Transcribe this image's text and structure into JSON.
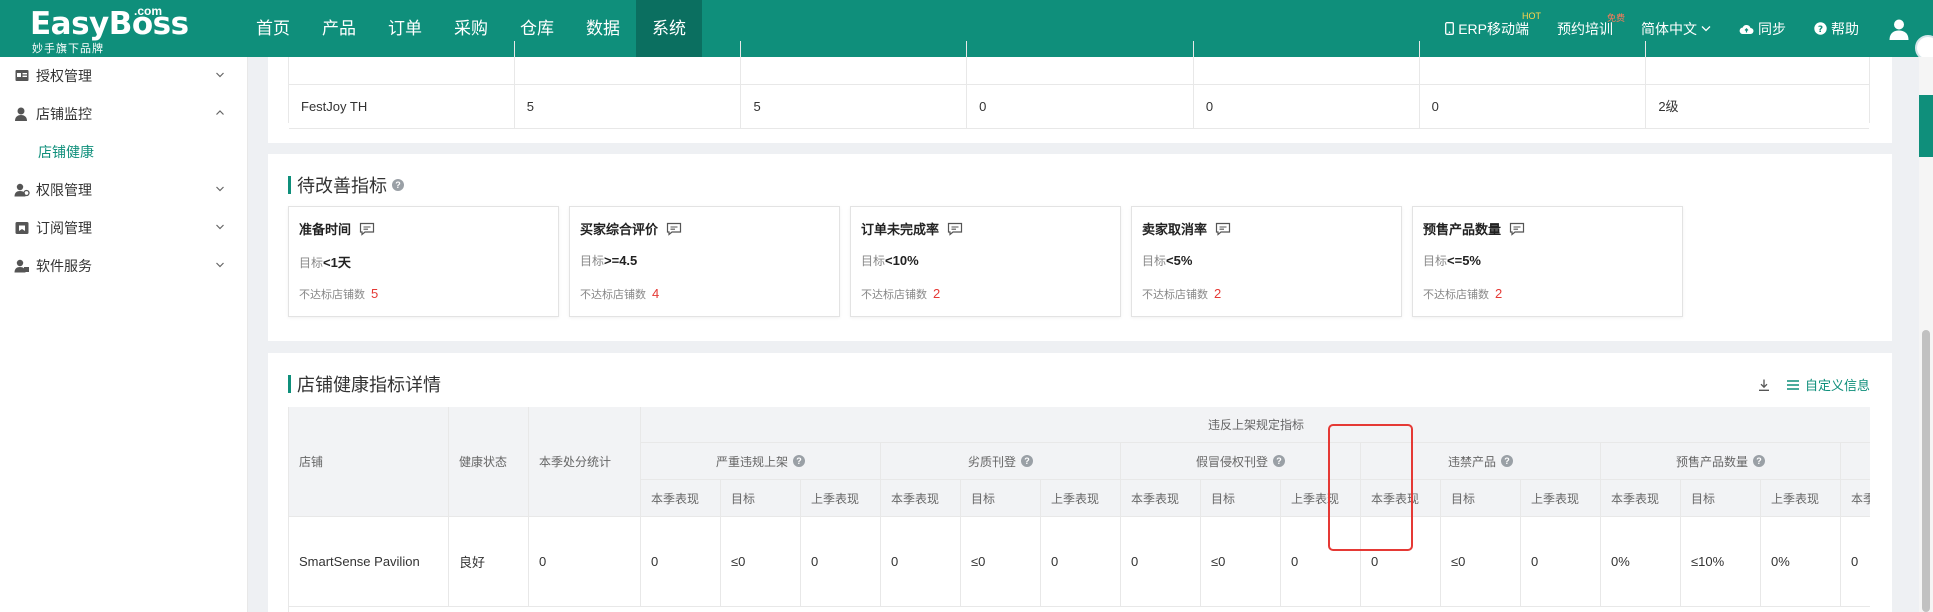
{
  "brand": {
    "name": "EasyBoss",
    "com": ".com",
    "tagline": "妙手旗下品牌"
  },
  "nav": [
    {
      "label": "首页",
      "active": false
    },
    {
      "label": "产品",
      "active": false
    },
    {
      "label": "订单",
      "active": false
    },
    {
      "label": "采购",
      "active": false
    },
    {
      "label": "仓库",
      "active": false
    },
    {
      "label": "数据",
      "active": false
    },
    {
      "label": "系统",
      "active": true
    }
  ],
  "header_right": {
    "erp_mobile": "ERP移动端",
    "hot": "HOT",
    "training": "预约培训",
    "free": "免费",
    "language": "简体中文",
    "sync": "同步",
    "help": "帮助"
  },
  "sidebar": {
    "items": [
      {
        "label": "授权管理",
        "expanded": false
      },
      {
        "label": "店铺监控",
        "expanded": true
      },
      {
        "label": "店铺健康",
        "sub": true
      },
      {
        "label": "权限管理",
        "expanded": false
      },
      {
        "label": "订阅管理",
        "expanded": false
      },
      {
        "label": "软件服务",
        "expanded": false
      }
    ]
  },
  "top_table": {
    "row": [
      "FestJoy TH",
      "5",
      "5",
      "0",
      "0",
      "0",
      "2级"
    ]
  },
  "improve": {
    "title": "待改善指标",
    "cards": [
      {
        "name": "准备时间",
        "goal_prefix": "目标",
        "goal": "<1天",
        "fail_label": "不达标店铺数",
        "fail": "5"
      },
      {
        "name": "买家综合评价",
        "goal_prefix": "目标",
        "goal": ">=4.5",
        "fail_label": "不达标店铺数",
        "fail": "4"
      },
      {
        "name": "订单未完成率",
        "goal_prefix": "目标",
        "goal": "<10%",
        "fail_label": "不达标店铺数",
        "fail": "2"
      },
      {
        "name": "卖家取消率",
        "goal_prefix": "目标",
        "goal": "<5%",
        "fail_label": "不达标店铺数",
        "fail": "2"
      },
      {
        "name": "预售产品数量",
        "goal_prefix": "目标",
        "goal": "<=5%",
        "fail_label": "不达标店铺数",
        "fail": "2"
      }
    ]
  },
  "detail": {
    "title": "店铺健康指标详情",
    "custom_label": "自定义信息",
    "headers": {
      "store": "店铺",
      "health": "健康状态",
      "penalty": "本季处分统计",
      "group": "违反上架规定指标",
      "metrics": [
        "严重违规上架",
        "劣质刊登",
        "假冒侵权刊登",
        "违禁产品",
        "预售产品数量"
      ],
      "sub": [
        "本季表现",
        "目标",
        "上季表现"
      ],
      "partial": "本季"
    },
    "row": {
      "store": "SmartSense Pavilion",
      "health": "良好",
      "penalty": "0",
      "values": [
        "0",
        "≤0",
        "0",
        "0",
        "≤0",
        "0",
        "0",
        "≤0",
        "0",
        "0",
        "≤0",
        "0",
        "0%",
        "≤10%",
        "0%",
        "0"
      ]
    }
  },
  "colors": {
    "brand": "#0f8f7b",
    "danger": "#e53935"
  }
}
